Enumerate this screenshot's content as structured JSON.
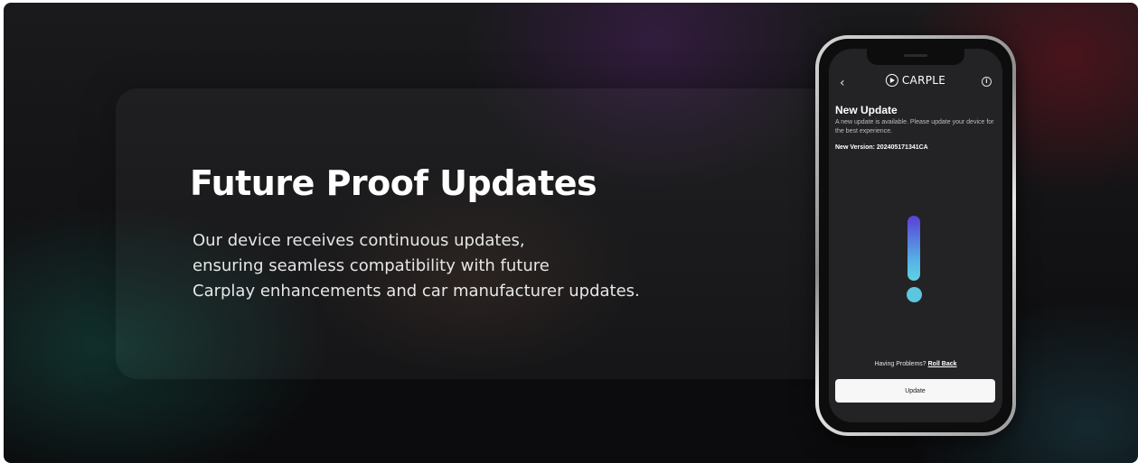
{
  "hero": {
    "headline": "Future Proof Updates",
    "body_lines": [
      "Our device receives continuous updates,",
      "ensuring seamless compatibility with future",
      "Carplay enhancements and car manufacturer updates."
    ]
  },
  "app": {
    "back_icon": "chevron-left-icon",
    "brand": "CARPLE",
    "brand_icon": "play-circle-icon",
    "info_icon": "info-icon",
    "update_title": "New Update",
    "update_description": "A new update is available. Please update your device for the best experience.",
    "version_text": "New Version: 202405171341CA",
    "problem_prefix": "Having Problems?",
    "rollback_label": "Roll Back",
    "update_button_label": "Update",
    "colors": {
      "alert_top": "#5a3fd6",
      "alert_bottom": "#5fd1e2",
      "button_bg": "#f7f7f7",
      "screen_bg": "#232325"
    }
  }
}
